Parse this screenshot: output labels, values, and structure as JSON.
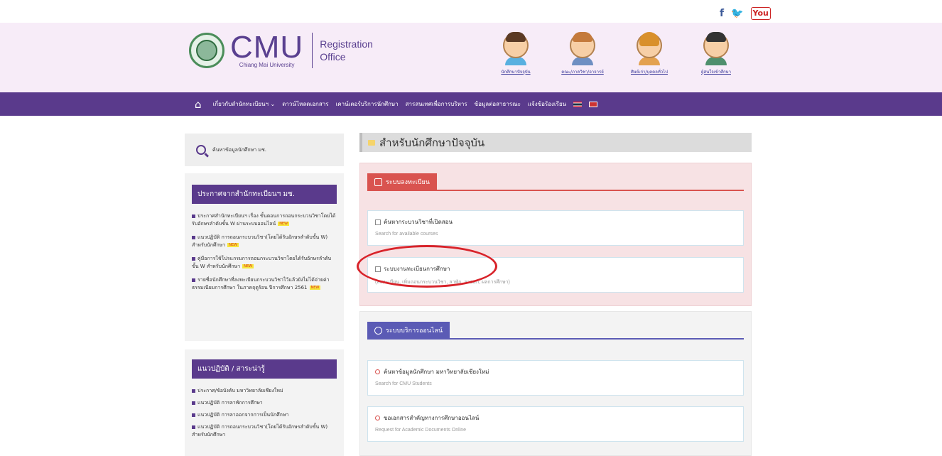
{
  "social": {
    "facebook": "f",
    "twitter": "🐦",
    "youtube": "You"
  },
  "header": {
    "logo": {
      "title": "CMU",
      "subtitle": "Chiang Mai University",
      "office_line1": "Registration",
      "office_line2": "Office"
    },
    "personas": [
      {
        "label": "นักศึกษาปัจจุบัน"
      },
      {
        "label": "คณะ/ภาควิชา/อาจารย์"
      },
      {
        "label": "ศิษย์เก่า/บุคคลทั่วไป"
      },
      {
        "label": "ผู้สนใจเข้าศึกษา"
      }
    ]
  },
  "nav": {
    "items": [
      "เกี่ยวกับสำนักทะเบียนฯ ⌄",
      "ดาวน์โหลดเอกสาร",
      "เคาน์เตอร์บริการนักศึกษา",
      "สารสนเทศเพื่อการบริหาร",
      "ข้อมูลต่อสาธารณะ",
      "แจ้งข้อร้องเรียน"
    ]
  },
  "sidebar": {
    "search_label": "ค้นหาข้อมูลนักศึกษา มช.",
    "announcements": {
      "heading": "ประกาศจากสำนักทะเบียนฯ มช.",
      "items": [
        "ประกาศสำนักทะเบียนฯ เรื่อง ขั้นตอนการถอนกระบวนวิชาโดยได้รับอักษรลำดับขั้น W ผ่านระบบออนไลน์",
        "แนวปฏิบัติ การถอนกระบวนวิชา(โดยได้รับอักษรลำดับขั้น W) สำหรับนักศึกษา",
        "คู่มือการใช้โปรแกรมการถอนกระบวนวิชาโดยได้รับอักษรลำดับขั้น W สำหรับนักศึกษา",
        "รายชื่อนักศึกษาที่ลงทะเบียนกระบวนวิชาไว้แล้วยังไม่ได้จ่ายค่าธรรมเนียมการศึกษา ในภาคฤดูร้อน ปีการศึกษา 2561"
      ],
      "new_badge": "NEW"
    },
    "guidelines": {
      "heading": "แนวปฏิบัติ / สาระน่ารู้",
      "items": [
        "ประกาศ/ข้อบังคับ มหาวิทยาลัยเชียงใหม่",
        "แนวปฏิบัติ การลาพักการศึกษา",
        "แนวปฏิบัติ การลาออกจากการเป็นนักศึกษา",
        "แนวปฏิบัติ การถอนกระบวนวิชา(โดยได้รับอักษรลำดับขั้น W) สำหรับนักศึกษา"
      ]
    }
  },
  "main": {
    "title": "สำหรับนักศึกษาปัจจุบัน",
    "registration": {
      "heading": "ระบบลงทะเบียน",
      "cards": [
        {
          "title": "ค้นหากระบวนวิชาที่เปิดสอน",
          "sub": "Search for available courses"
        },
        {
          "title": "ระบบงานทะเบียนการศึกษา",
          "sub": "(ลงทะเบียน, เพิ่มถอนกระบวนวิชา, ลาพัก, ลาออก, ผลการศึกษา)"
        }
      ]
    },
    "online": {
      "heading": "ระบบบริการออนไลน์",
      "cards": [
        {
          "title": "ค้นหาข้อมูลนักศึกษา มหาวิทยาลัยเชียงใหม่",
          "sub": "Search for CMU Students"
        },
        {
          "title": "ขอเอกสารสำคัญทางการศึกษาออนไลน์",
          "sub": "Request for Academic Documents Online"
        }
      ]
    }
  },
  "colors": {
    "brand_purple": "#5a3a8c",
    "header_bg": "#f7ecf8",
    "reg_red": "#d9534f",
    "online_blue": "#5b5bb5",
    "annotation_red": "#d8232a"
  }
}
